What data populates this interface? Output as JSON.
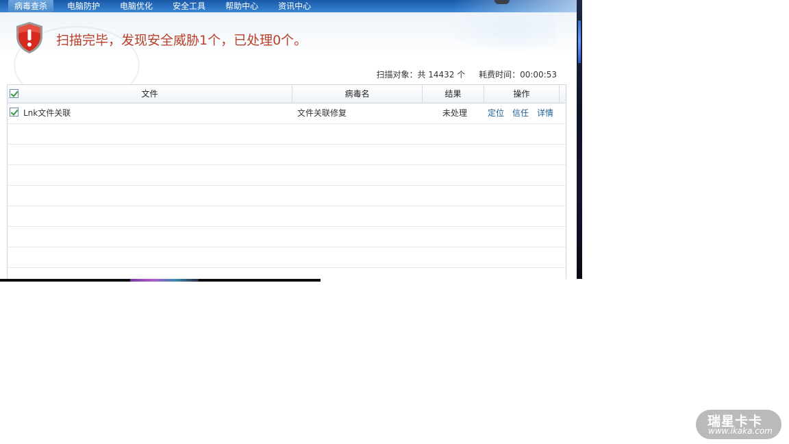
{
  "nav": {
    "items": [
      {
        "label": "病毒查杀",
        "active": true
      },
      {
        "label": "电脑防护",
        "active": false
      },
      {
        "label": "电脑优化",
        "active": false
      },
      {
        "label": "安全工具",
        "active": false
      },
      {
        "label": "帮助中心",
        "active": false
      },
      {
        "label": "资讯中心",
        "active": false
      }
    ]
  },
  "header": {
    "icon": "shield-alert-icon",
    "title": "扫描完毕，发现安全威胁1个，已处理0个。",
    "scan_objects": "扫描对象：共 14432 个",
    "elapsed": "耗费时间：00:00:53"
  },
  "table": {
    "columns": [
      "文件",
      "病毒名",
      "结果",
      "操作"
    ],
    "header_checked": true,
    "rows": [
      {
        "checked": true,
        "file": "Lnk文件关联",
        "virus": "文件关联修复",
        "result": "未处理",
        "actions": [
          "定位",
          "信任",
          "详情"
        ]
      }
    ],
    "empty_rows": 7
  },
  "watermark": {
    "name": "瑞星卡卡",
    "url": "www.ikaka.com"
  },
  "colors": {
    "nav_bg": "#2b74c4",
    "title_red": "#b8402a",
    "link_blue": "#1c5f96",
    "check_green": "#2a9a3a"
  }
}
